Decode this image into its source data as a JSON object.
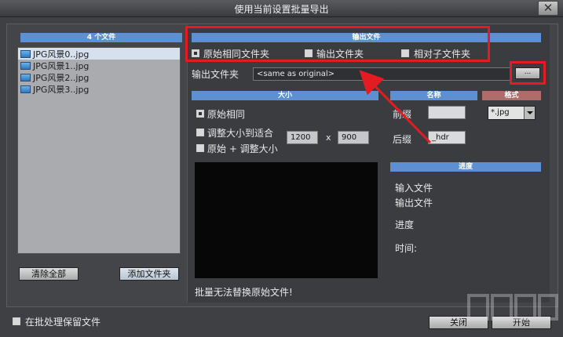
{
  "window": {
    "title": "使用当前设置批量导出",
    "close_icon": "close-icon"
  },
  "files": {
    "header": "4 个文件",
    "items": [
      "JPG风景0..jpg",
      "JPG风景1..jpg",
      "JPG风景2..jpg",
      "JPG风景3..jpg"
    ],
    "clear_all": "清除全部",
    "add_folder": "添加文件夹"
  },
  "output": {
    "header": "输出文件",
    "options": [
      "原始相同文件夹",
      "输出文件夹",
      "相对子文件夹"
    ],
    "folder_label": "输出文件夹",
    "folder_value": "<same as original>",
    "browse_label": "..."
  },
  "size": {
    "header": "大小",
    "options": [
      "原始相同",
      "调整大小到适合",
      "原始 + 调整大小"
    ],
    "width": "1200",
    "by": "x",
    "height": "900"
  },
  "naming": {
    "header": "名称",
    "prefix_label": "前缀",
    "prefix_value": "",
    "suffix_label": "后缀",
    "suffix_value": "_hdr"
  },
  "format": {
    "header": "格式",
    "value": "*.jpg"
  },
  "progress": {
    "header": "进度",
    "input_label": "输入文件",
    "output_label": "输出文件",
    "progress_label": "进度",
    "time_label": "时间:"
  },
  "warning": "批量无法替换原始文件!",
  "footer": {
    "keep_files": "在批处理保留文件",
    "close": "关闭",
    "start": "开始"
  }
}
